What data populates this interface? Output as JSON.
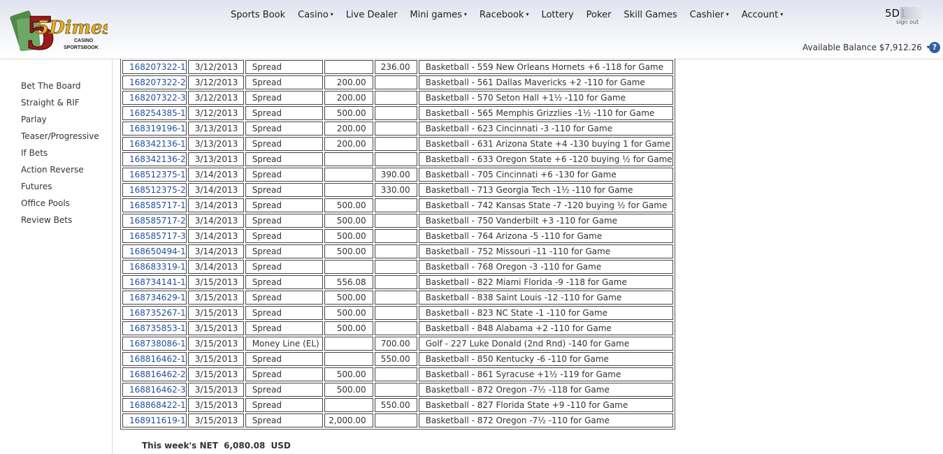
{
  "logo": {
    "text": "5Dimes",
    "sub1": "CASINO",
    "sub2": "SPORTSBOOK"
  },
  "nav": [
    {
      "label": "Sports Book",
      "dropdown": false
    },
    {
      "label": "Casino",
      "dropdown": true
    },
    {
      "label": "Live Dealer",
      "dropdown": false
    },
    {
      "label": "Mini games",
      "dropdown": true
    },
    {
      "label": "Racebook",
      "dropdown": true
    },
    {
      "label": "Lottery",
      "dropdown": false
    },
    {
      "label": "Poker",
      "dropdown": false
    },
    {
      "label": "Skill Games",
      "dropdown": false
    },
    {
      "label": "Cashier",
      "dropdown": true
    },
    {
      "label": "Account",
      "dropdown": true
    }
  ],
  "account": {
    "id": "5D1",
    "signout": "sign out"
  },
  "balance": {
    "label": "Available Balance $7,912.26",
    "caret": "▾"
  },
  "help_icon": "?",
  "sidebar": [
    "Bet The Board",
    "Straight & RIF",
    "Parlay",
    "Teaser/Progressive",
    "If Bets",
    "Action Reverse",
    "Futures",
    "Office Pools",
    "Review Bets"
  ],
  "bets": [
    {
      "ticket": "168207322-1",
      "date": "3/12/2013",
      "type": "Spread",
      "risk": "",
      "win": "236.00",
      "desc": "Basketball - 559 New Orleans Hornets +6 -118 for Game"
    },
    {
      "ticket": "168207322-2",
      "date": "3/12/2013",
      "type": "Spread",
      "risk": "200.00",
      "win": "",
      "desc": "Basketball - 561 Dallas Mavericks +2 -110 for Game"
    },
    {
      "ticket": "168207322-3",
      "date": "3/12/2013",
      "type": "Spread",
      "risk": "200.00",
      "win": "",
      "desc": "Basketball - 570 Seton Hall +1½ -110 for Game"
    },
    {
      "ticket": "168254385-1",
      "date": "3/12/2013",
      "type": "Spread",
      "risk": "500.00",
      "win": "",
      "desc": "Basketball - 565 Memphis Grizzlies -1½ -110 for Game"
    },
    {
      "ticket": "168319196-1",
      "date": "3/13/2013",
      "type": "Spread",
      "risk": "200.00",
      "win": "",
      "desc": "Basketball - 623 Cincinnati -3 -110 for Game"
    },
    {
      "ticket": "168342136-1",
      "date": "3/13/2013",
      "type": "Spread",
      "risk": "200.00",
      "win": "",
      "desc": "Basketball - 631 Arizona State +4 -130 buying 1 for Game"
    },
    {
      "ticket": "168342136-2",
      "date": "3/13/2013",
      "type": "Spread",
      "risk": "",
      "win": "",
      "desc": "Basketball - 633 Oregon State +6 -120 buying ½ for Game"
    },
    {
      "ticket": "168512375-1",
      "date": "3/14/2013",
      "type": "Spread",
      "risk": "",
      "win": "390.00",
      "desc": "Basketball - 705 Cincinnati +6 -130 for Game"
    },
    {
      "ticket": "168512375-2",
      "date": "3/14/2013",
      "type": "Spread",
      "risk": "",
      "win": "330.00",
      "desc": "Basketball - 713 Georgia Tech -1½ -110 for Game"
    },
    {
      "ticket": "168585717-1",
      "date": "3/14/2013",
      "type": "Spread",
      "risk": "500.00",
      "win": "",
      "desc": "Basketball - 742 Kansas State -7 -120 buying ½ for Game"
    },
    {
      "ticket": "168585717-2",
      "date": "3/14/2013",
      "type": "Spread",
      "risk": "500.00",
      "win": "",
      "desc": "Basketball - 750 Vanderbilt +3 -110 for Game"
    },
    {
      "ticket": "168585717-3",
      "date": "3/14/2013",
      "type": "Spread",
      "risk": "500.00",
      "win": "",
      "desc": "Basketball - 764 Arizona -5 -110 for Game"
    },
    {
      "ticket": "168650494-1",
      "date": "3/14/2013",
      "type": "Spread",
      "risk": "500.00",
      "win": "",
      "desc": "Basketball - 752 Missouri -11 -110 for Game"
    },
    {
      "ticket": "168683319-1",
      "date": "3/14/2013",
      "type": "Spread",
      "risk": "",
      "win": "",
      "desc": "Basketball - 768 Oregon -3 -110 for Game"
    },
    {
      "ticket": "168734141-1",
      "date": "3/15/2013",
      "type": "Spread",
      "risk": "556.08",
      "win": "",
      "desc": "Basketball - 822 Miami Florida -9 -118 for Game"
    },
    {
      "ticket": "168734629-1",
      "date": "3/15/2013",
      "type": "Spread",
      "risk": "500.00",
      "win": "",
      "desc": "Basketball - 838 Saint Louis -12 -110 for Game"
    },
    {
      "ticket": "168735267-1",
      "date": "3/15/2013",
      "type": "Spread",
      "risk": "500.00",
      "win": "",
      "desc": "Basketball - 823 NC State -1 -110 for Game"
    },
    {
      "ticket": "168735853-1",
      "date": "3/15/2013",
      "type": "Spread",
      "risk": "500.00",
      "win": "",
      "desc": "Basketball - 848 Alabama +2 -110 for Game"
    },
    {
      "ticket": "168738086-1",
      "date": "3/15/2013",
      "type": "Money Line (EL)",
      "risk": "",
      "win": "700.00",
      "desc": "Golf - 227 Luke Donald (2nd Rnd) -140 for Game"
    },
    {
      "ticket": "168816462-1",
      "date": "3/15/2013",
      "type": "Spread",
      "risk": "",
      "win": "550.00",
      "desc": "Basketball - 850 Kentucky -6 -110 for Game"
    },
    {
      "ticket": "168816462-2",
      "date": "3/15/2013",
      "type": "Spread",
      "risk": "500.00",
      "win": "",
      "desc": "Basketball - 861 Syracuse +1½ -119 for Game"
    },
    {
      "ticket": "168816462-3",
      "date": "3/15/2013",
      "type": "Spread",
      "risk": "500.00",
      "win": "",
      "desc": "Basketball - 872 Oregon -7½ -118 for Game"
    },
    {
      "ticket": "168868422-1",
      "date": "3/15/2013",
      "type": "Spread",
      "risk": "",
      "win": "550.00",
      "desc": "Basketball - 827 Florida State +9 -110 for Game"
    },
    {
      "ticket": "168911619-1",
      "date": "3/15/2013",
      "type": "Spread",
      "risk": "2,000.00",
      "win": "",
      "desc": "Basketball - 872 Oregon -7½ -110 for Game"
    }
  ],
  "net": {
    "label": "This week's NET",
    "value": "6,080.08",
    "currency": "USD"
  }
}
